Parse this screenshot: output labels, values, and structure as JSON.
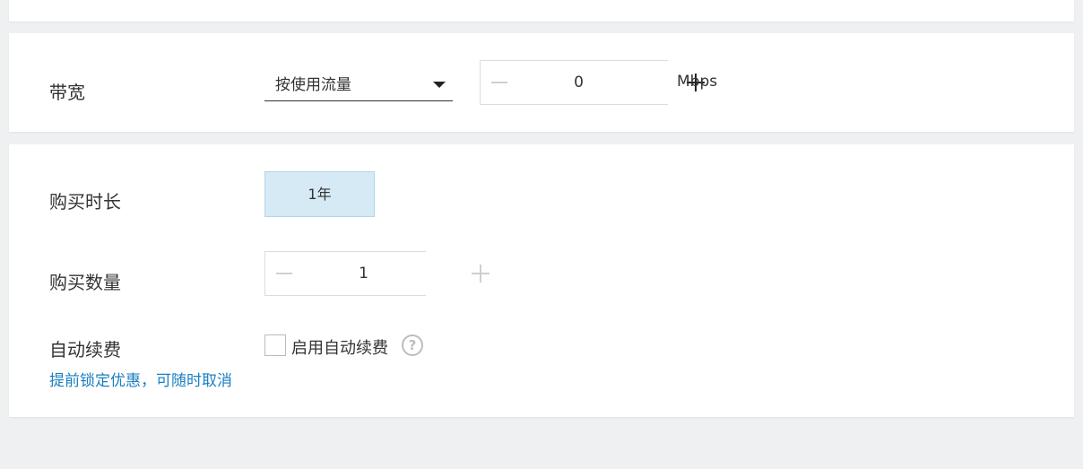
{
  "bandwidth": {
    "label": "带宽",
    "billing_mode": "按使用流量",
    "value": "0",
    "unit": "Mbps"
  },
  "purchase": {
    "duration_label": "购买时长",
    "duration_option": "1年",
    "quantity_label": "购买数量",
    "quantity_value": "1",
    "auto_renew_label": "自动续费",
    "auto_renew_checkbox_label": "启用自动续费",
    "auto_renew_checked": false,
    "promo_text": "提前锁定优惠，可随时取消",
    "help_symbol": "?"
  },
  "colors": {
    "accent_link": "#1a7fc1",
    "chip_bg": "#d6eaf6"
  }
}
